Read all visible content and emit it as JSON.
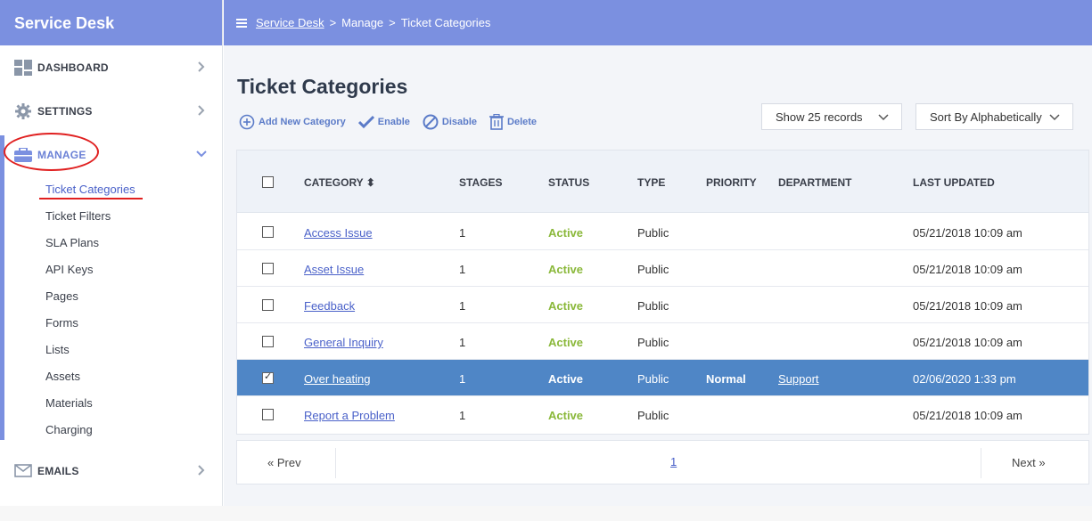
{
  "sidebar": {
    "brand": "Service Desk",
    "items": [
      {
        "label": "DASHBOARD",
        "icon": "dashboard-icon"
      },
      {
        "label": "SETTINGS",
        "icon": "gear-icon"
      },
      {
        "label": "MANAGE",
        "icon": "briefcase-icon"
      },
      {
        "label": "EMAILS",
        "icon": "envelope-icon"
      }
    ],
    "sub_items": [
      "Ticket Categories",
      "Ticket Filters",
      "SLA Plans",
      "API Keys",
      "Pages",
      "Forms",
      "Lists",
      "Assets",
      "Materials",
      "Charging"
    ],
    "active_sub_item": "Ticket Categories"
  },
  "header": {
    "breadcrumb": [
      "Service Desk",
      "Manage",
      "Ticket Categories"
    ],
    "separator": ">"
  },
  "main": {
    "title": "Ticket Categories",
    "actions": [
      "Add New Category",
      "Enable",
      "Disable",
      "Delete"
    ],
    "show_records": "Show 25 records",
    "sort_by": "Sort By Alphabetically",
    "columns": [
      "CATEGORY",
      "STAGES",
      "STATUS",
      "TYPE",
      "PRIORITY",
      "DEPARTMENT",
      "LAST UPDATED"
    ],
    "rows": [
      {
        "category": "Access Issue",
        "stages": "1",
        "status": "Active",
        "type": "Public",
        "priority": "",
        "department": "",
        "updated": "05/21/2018 10:09 am",
        "selected": false
      },
      {
        "category": "Asset Issue",
        "stages": "1",
        "status": "Active",
        "type": "Public",
        "priority": "",
        "department": "",
        "updated": "05/21/2018 10:09 am",
        "selected": false
      },
      {
        "category": "Feedback",
        "stages": "1",
        "status": "Active",
        "type": "Public",
        "priority": "",
        "department": "",
        "updated": "05/21/2018 10:09 am",
        "selected": false
      },
      {
        "category": "General Inquiry",
        "stages": "1",
        "status": "Active",
        "type": "Public",
        "priority": "",
        "department": "",
        "updated": "05/21/2018 10:09 am",
        "selected": false
      },
      {
        "category": "Over heating",
        "stages": "1",
        "status": "Active",
        "type": "Public",
        "priority": "Normal",
        "department": "Support",
        "updated": "02/06/2020 1:33 pm",
        "selected": true
      },
      {
        "category": "Report a Problem",
        "stages": "1",
        "status": "Active",
        "type": "Public",
        "priority": "",
        "department": "",
        "updated": "05/21/2018 10:09 am",
        "selected": false
      }
    ],
    "pager": {
      "prev": "« Prev",
      "page": "1",
      "next": "Next »"
    }
  },
  "colors": {
    "header": "#7b90e0",
    "accent": "#4f86c6",
    "active_status": "#8ab83a",
    "annotation": "#e02020"
  }
}
